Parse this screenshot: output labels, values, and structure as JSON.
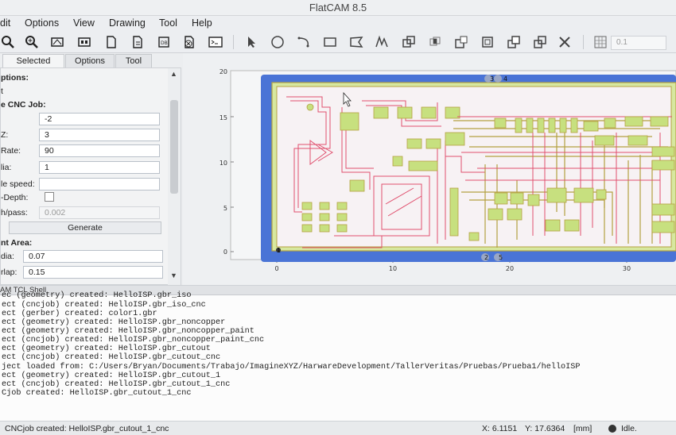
{
  "window": {
    "title": "FlatCAM 8.5"
  },
  "menu": [
    "dit",
    "Options",
    "View",
    "Drawing",
    "Tool",
    "Help"
  ],
  "toolbar": {
    "icons": [
      "zoom-fit-icon",
      "zoom-in-icon",
      "new-geometry-icon",
      "new-gerber-icon",
      "new-file-icon",
      "open-file-icon",
      "excellon-icon",
      "delete-icon",
      "shell-icon",
      "select-arrow-icon",
      "circle-icon",
      "arc-icon",
      "rectangle-icon",
      "polygon-icon",
      "path-icon",
      "union-icon",
      "intersection-icon",
      "subtract-icon",
      "buffer-icon",
      "copy-icon",
      "cut-icon",
      "grid-icon"
    ],
    "grid_value": "0.1"
  },
  "tabs": [
    "Selected",
    "Options",
    "Tool"
  ],
  "left_panel": {
    "options_heading": "ptions:",
    "t_label": "t",
    "cnc_heading": "e CNC Job:",
    "cut_z_value": "-2",
    "z_label": "Z:",
    "z_value": "3",
    "rate_label": "Rate:",
    "rate_value": "90",
    "dia_label": "lia:",
    "dia_value": "1",
    "spindle_label": "le speed:",
    "spindle_value": "",
    "depth_label": "-Depth:",
    "pass_label": "h/pass:",
    "pass_value": "0.002",
    "generate_label": "Generate",
    "paint_heading": "nt Area:",
    "tool_dia_label": "dia:",
    "tool_dia_value": "0.07",
    "overlap_label": "rlap:",
    "overlap_value": "0.15"
  },
  "plot": {
    "y_ticks": [
      "20",
      "15",
      "10",
      "5",
      "0"
    ],
    "x_ticks": [
      "0",
      "10",
      "20",
      "30"
    ],
    "corner_labels": [
      "3",
      "4",
      "1",
      "2",
      "5"
    ],
    "colors": {
      "board": "#4a74d6",
      "copper": "#c7e07f",
      "trace": "#e0506e",
      "outline": "#b4a140"
    }
  },
  "shell": {
    "title": "AM TCL Shell",
    "lines": [
      "ec  (geometry) created: HelloISP.gbr_iso",
      "ect (cncjob) created: HelloISP.gbr_iso_cnc",
      "ect (gerber) created: color1.gbr",
      "ect (geometry) created: HelloISP.gbr_noncopper",
      "ect (geometry) created: HelloISP.gbr_noncopper_paint",
      "ect (cncjob) created: HelloISP.gbr_noncopper_paint_cnc",
      "ect (geometry) created: HelloISP.gbr_cutout",
      "ect (cncjob) created: HelloISP.gbr_cutout_cnc",
      "ject loaded from: C:/Users/Bryan/Documents/Trabajo/ImagineXYZ/HarwareDevelopment/TallerVeritas/Pruebas/Prueba1/helloISP",
      "ect (geometry) created: HelloISP.gbr_cutout_1",
      "ect (cncjob) created: HelloISP.gbr_cutout_1_cnc",
      "Cjob created: HelloISP.gbr_cutout_1_cnc"
    ]
  },
  "status": {
    "message": "CNCjob created: HelloISP.gbr_cutout_1_cnc",
    "x": "X: 6.1151",
    "y": "Y: 17.6364",
    "units": "[mm]",
    "state": "Idle."
  }
}
